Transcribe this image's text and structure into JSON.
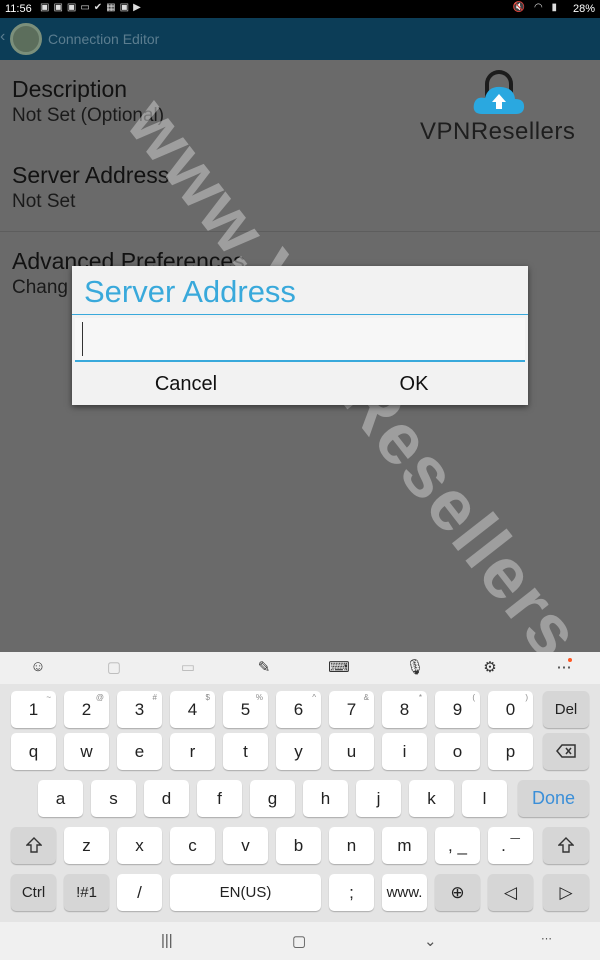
{
  "status_bar": {
    "time": "11:56",
    "battery": "28%"
  },
  "app_bar": {
    "title": "Connection Editor"
  },
  "preferences": [
    {
      "title": "Description",
      "summary": "Not Set (Optional)"
    },
    {
      "title": "Server Address",
      "summary": "Not Set"
    },
    {
      "title": "Advanced Preferences",
      "summary": "Chang"
    }
  ],
  "brand": {
    "name": "VPNResellers"
  },
  "watermark": {
    "text": "www.VPNResellers.me"
  },
  "dialog": {
    "title": "Server Address",
    "input_value": "",
    "cancel_label": "Cancel",
    "ok_label": "OK"
  },
  "keyboard": {
    "number_row": [
      {
        "label": "1",
        "sup": "~"
      },
      {
        "label": "2",
        "sup": "@"
      },
      {
        "label": "3",
        "sup": "#"
      },
      {
        "label": "4",
        "sup": "$"
      },
      {
        "label": "5",
        "sup": "%"
      },
      {
        "label": "6",
        "sup": "^"
      },
      {
        "label": "7",
        "sup": "&"
      },
      {
        "label": "8",
        "sup": "*"
      },
      {
        "label": "9",
        "sup": "("
      },
      {
        "label": "0",
        "sup": ")"
      }
    ],
    "del_label": "Del",
    "row1": [
      "q",
      "w",
      "e",
      "r",
      "t",
      "y",
      "u",
      "i",
      "o",
      "p"
    ],
    "row2": [
      "a",
      "s",
      "d",
      "f",
      "g",
      "h",
      "j",
      "k",
      "l"
    ],
    "done_label": "Done",
    "row3": [
      "z",
      "x",
      "c",
      "v",
      "b",
      "n",
      "m"
    ],
    "comma_label": ", _",
    "period_label": ". ¯",
    "ctrl_label": "Ctrl",
    "symbols_label": "!#1",
    "slash_label": "/",
    "space_label": "EN(US)",
    "semicolon_label": ";",
    "www_label": "www."
  },
  "accent_color": "#39a9db"
}
